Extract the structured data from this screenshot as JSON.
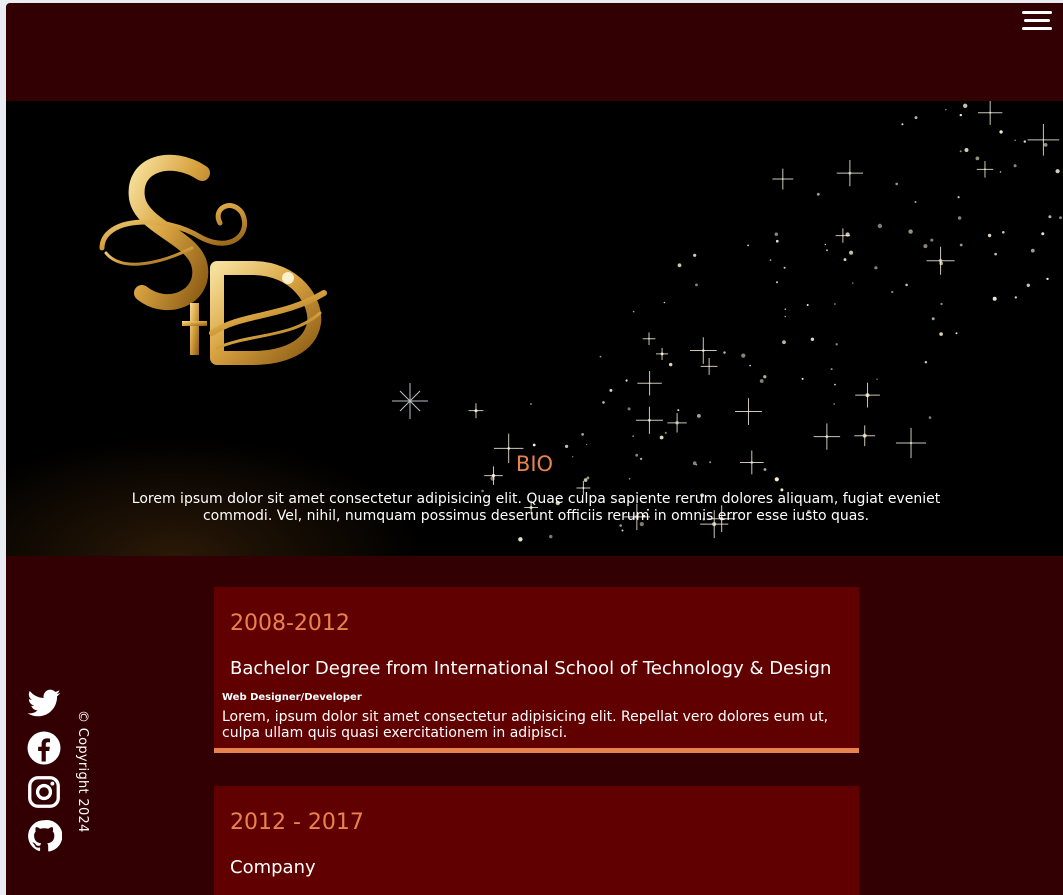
{
  "header": {
    "menu_icon": "hamburger-menu-icon"
  },
  "hero": {
    "logo_icon": "sd-monogram-logo",
    "bio_title": "BIO",
    "bio_text": "Lorem ipsum dolor sit amet consectetur adipisicing elit. Quae culpa sapiente rerum dolores aliquam, fugiat eveniet commodi. Vel, nihil, numquam possimus deserunt officiis rerum in omnis error esse iusto quas."
  },
  "social": {
    "items": [
      {
        "icon": "twitter-icon"
      },
      {
        "icon": "facebook-icon"
      },
      {
        "icon": "instagram-icon"
      },
      {
        "icon": "github-icon"
      }
    ],
    "copyright": "© Copyright 2024"
  },
  "timeline": [
    {
      "years": "2008-2012",
      "title": "Bachelor Degree from International School of Technology & Design",
      "role": "Web Designer/Developer",
      "description": "Lorem, ipsum dolor sit amet consectetur adipisicing elit. Repellat vero dolores eum ut, culpa ullam quis quasi exercitationem in adipisci."
    },
    {
      "years": "2012 - 2017",
      "title": "Company"
    }
  ],
  "colors": {
    "page_bg": "#320002",
    "card_bg": "#610000",
    "accent": "#e8834f",
    "hero_bg": "#000000",
    "gold": "#d9a441"
  }
}
